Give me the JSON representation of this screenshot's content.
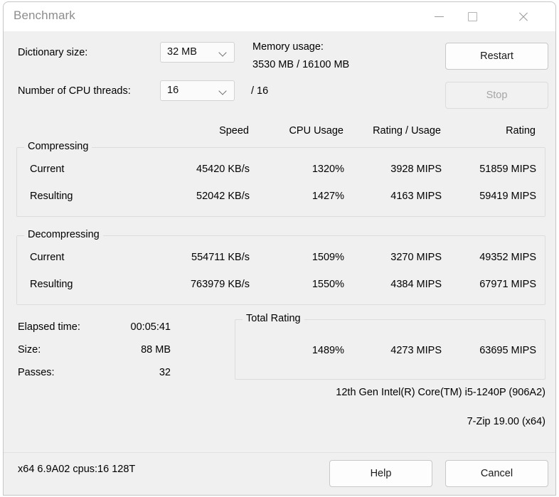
{
  "window": {
    "title": "Benchmark",
    "controls": {
      "minimize": "minimize-icon",
      "maximize": "maximize-icon",
      "close": "close-icon"
    }
  },
  "settings": {
    "dictionary_label": "Dictionary size:",
    "dictionary_value": "32 MB",
    "threads_label": "Number of CPU threads:",
    "threads_value": "16",
    "threads_max": "/ 16",
    "memory_label": "Memory usage:",
    "memory_value": "3530 MB / 16100 MB",
    "restart_button": "Restart",
    "stop_button": "Stop"
  },
  "columns": {
    "speed": "Speed",
    "cpu_usage": "CPU Usage",
    "rating_usage": "Rating / Usage",
    "rating": "Rating"
  },
  "compressing": {
    "legend": "Compressing",
    "rows": [
      {
        "label": "Current",
        "speed": "45420 KB/s",
        "cpu_usage": "1320%",
        "rating_usage": "3928 MIPS",
        "rating": "51859 MIPS"
      },
      {
        "label": "Resulting",
        "speed": "52042 KB/s",
        "cpu_usage": "1427%",
        "rating_usage": "4163 MIPS",
        "rating": "59419 MIPS"
      }
    ]
  },
  "decompressing": {
    "legend": "Decompressing",
    "rows": [
      {
        "label": "Current",
        "speed": "554711 KB/s",
        "cpu_usage": "1509%",
        "rating_usage": "3270 MIPS",
        "rating": "49352 MIPS"
      },
      {
        "label": "Resulting",
        "speed": "763979 KB/s",
        "cpu_usage": "1550%",
        "rating_usage": "4384 MIPS",
        "rating": "67971 MIPS"
      }
    ]
  },
  "stats": {
    "elapsed_label": "Elapsed time:",
    "elapsed_value": "00:05:41",
    "size_label": "Size:",
    "size_value": "88 MB",
    "passes_label": "Passes:",
    "passes_value": "32"
  },
  "total_rating": {
    "legend": "Total Rating",
    "cpu_usage": "1489%",
    "rating_usage": "4273 MIPS",
    "rating": "63695 MIPS"
  },
  "info": {
    "cpu": "12th Gen Intel(R) Core(TM) i5-1240P (906A2)",
    "version": "7-Zip 19.00 (x64)"
  },
  "footer": {
    "status": "x64 6.9A02 cpus:16 128T",
    "help_button": "Help",
    "cancel_button": "Cancel"
  }
}
